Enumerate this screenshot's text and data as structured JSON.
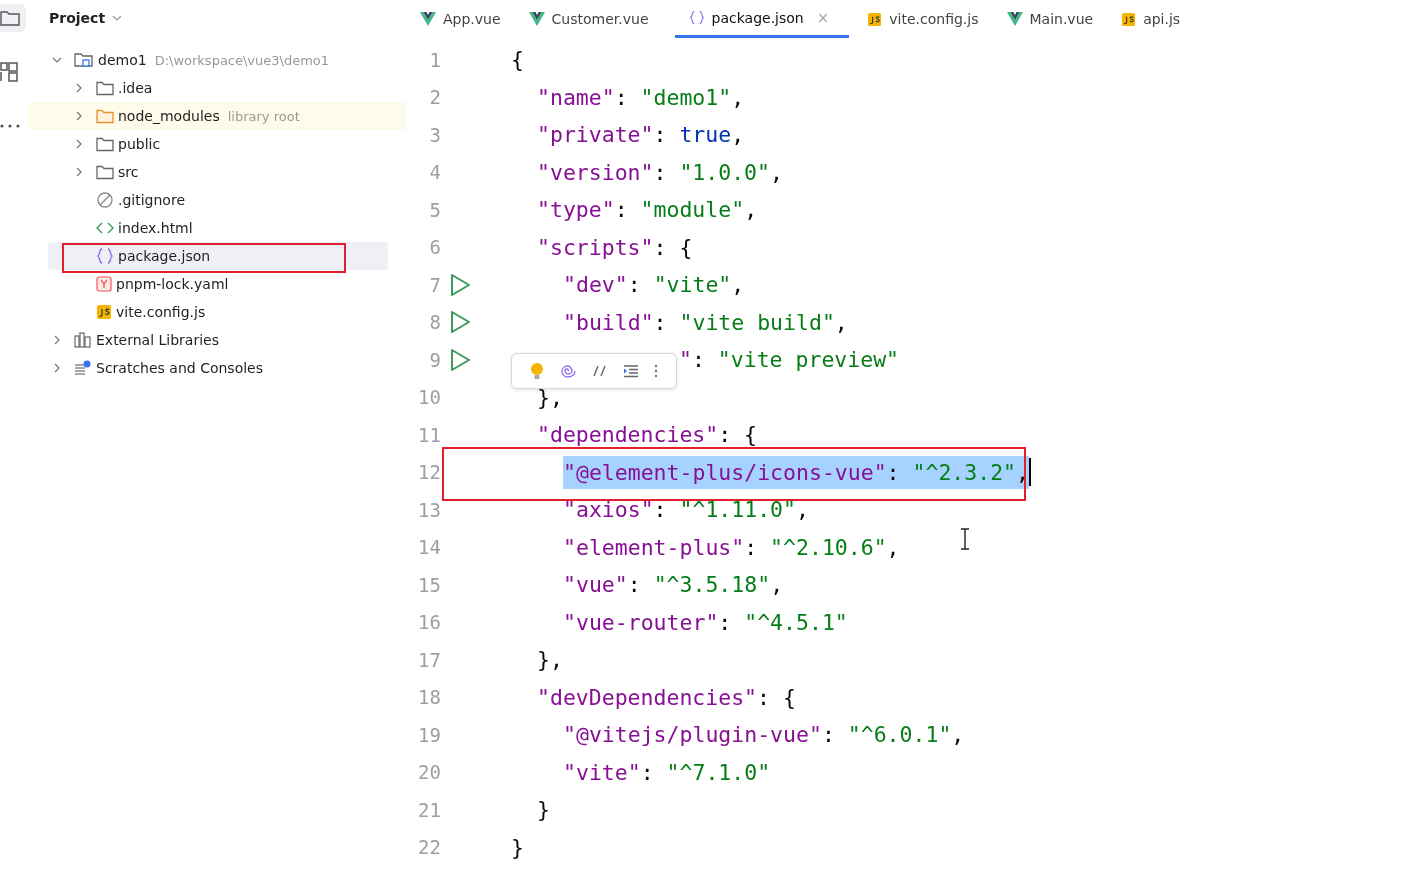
{
  "toolstrip": [
    {
      "kind": "folder",
      "selected": true
    },
    {
      "kind": "structure",
      "selected": false
    },
    {
      "kind": "more",
      "selected": false
    }
  ],
  "project": {
    "title": "Project",
    "tree": [
      {
        "label": "demo1",
        "hint": "D:\\workspace\\vue3\\demo1",
        "kind": "module",
        "expanded": true,
        "selected": false,
        "children": [
          {
            "label": ".idea",
            "kind": "folder",
            "expanded": false,
            "selected": false
          },
          {
            "label": "node_modules",
            "hint": "library root",
            "kind": "library-folder",
            "expanded": false,
            "selected": false
          },
          {
            "label": "public",
            "kind": "folder",
            "expanded": false,
            "selected": false
          },
          {
            "label": "src",
            "kind": "folder",
            "expanded": false,
            "selected": false
          },
          {
            "label": ".gitignore",
            "kind": "ignore",
            "selected": false
          },
          {
            "label": "index.html",
            "kind": "html",
            "selected": false
          },
          {
            "label": "package.json",
            "kind": "json",
            "selected": true,
            "marked": true
          },
          {
            "label": "pnpm-lock.yaml",
            "kind": "yaml",
            "selected": false
          },
          {
            "label": "vite.config.js",
            "kind": "js",
            "selected": false
          }
        ]
      },
      {
        "label": "External Libraries",
        "kind": "libraries",
        "expanded": false,
        "selected": false
      },
      {
        "label": "Scratches and Consoles",
        "kind": "scratches",
        "expanded": false,
        "selected": false
      }
    ]
  },
  "tabs": [
    {
      "label": "App.vue",
      "kind": "vue",
      "selected": false
    },
    {
      "label": "Customer.vue",
      "kind": "vue",
      "selected": false
    },
    {
      "label": "package.json",
      "kind": "json",
      "selected": true,
      "close": "×"
    },
    {
      "label": "vite.config.js",
      "kind": "js",
      "selected": false
    },
    {
      "label": "Main.vue",
      "kind": "vue",
      "selected": false
    },
    {
      "label": "api.js",
      "kind": "js",
      "selected": false
    }
  ],
  "editor": {
    "lines": [
      {
        "number": "1",
        "tokens": [
          {
            "kind": "punct",
            "text": "{"
          }
        ],
        "children": [
          {
            "number": "2",
            "tokens": [
              {
                "kind": "key",
                "text": "\"name\""
              },
              {
                "kind": "punct",
                "text": ": "
              },
              {
                "kind": "string",
                "text": "\"demo1\""
              },
              {
                "kind": "punct",
                "text": ","
              }
            ]
          },
          {
            "number": "3",
            "tokens": [
              {
                "kind": "key",
                "text": "\"private\""
              },
              {
                "kind": "punct",
                "text": ": "
              },
              {
                "kind": "keyword",
                "text": "true"
              },
              {
                "kind": "punct",
                "text": ","
              }
            ]
          },
          {
            "number": "4",
            "tokens": [
              {
                "kind": "key",
                "text": "\"version\""
              },
              {
                "kind": "punct",
                "text": ": "
              },
              {
                "kind": "string",
                "text": "\"1.0.0\""
              },
              {
                "kind": "punct",
                "text": ","
              }
            ]
          },
          {
            "number": "5",
            "tokens": [
              {
                "kind": "key",
                "text": "\"type\""
              },
              {
                "kind": "punct",
                "text": ": "
              },
              {
                "kind": "string",
                "text": "\"module\""
              },
              {
                "kind": "punct",
                "text": ","
              }
            ]
          },
          {
            "number": "6",
            "tokens": [
              {
                "kind": "key",
                "text": "\"scripts\""
              },
              {
                "kind": "punct",
                "text": ": {"
              }
            ],
            "children": [
              {
                "number": "7",
                "run": true,
                "tokens": [
                  {
                    "kind": "key",
                    "text": "\"dev\""
                  },
                  {
                    "kind": "punct",
                    "text": ": "
                  },
                  {
                    "kind": "string",
                    "text": "\"vite\""
                  },
                  {
                    "kind": "punct",
                    "text": ","
                  }
                ]
              },
              {
                "number": "8",
                "run": true,
                "tokens": [
                  {
                    "kind": "key",
                    "text": "\"build\""
                  },
                  {
                    "kind": "punct",
                    "text": ": "
                  },
                  {
                    "kind": "string",
                    "text": "\"vite build\""
                  },
                  {
                    "kind": "punct",
                    "text": ","
                  }
                ]
              },
              {
                "number": "9",
                "run": true,
                "popup": true,
                "tokens": [
                  {
                    "kind": "key",
                    "text": "\""
                  },
                  {
                    "kind": "punct",
                    "text": ": "
                  },
                  {
                    "kind": "string",
                    "text": "\"vite preview\""
                  }
                ]
              }
            ]
          },
          {
            "number": "10",
            "tokens": [
              {
                "kind": "punct",
                "text": "},"
              }
            ]
          },
          {
            "number": "11",
            "tokens": [
              {
                "kind": "key",
                "text": "\"dependencies\""
              },
              {
                "kind": "punct",
                "text": ": {"
              }
            ],
            "children": [
              {
                "number": "12",
                "current": true,
                "marked": true,
                "tokens": [
                  {
                    "kind": "key",
                    "text": "\"@element-plus/icons-vue\"",
                    "selected": true
                  },
                  {
                    "kind": "punct",
                    "text": ": ",
                    "selected": true
                  },
                  {
                    "kind": "string",
                    "text": "\"^2.3.2\"",
                    "selected": true
                  },
                  {
                    "kind": "punct",
                    "text": ",",
                    "selected": true
                  }
                ]
              },
              {
                "number": "13",
                "tokens": [
                  {
                    "kind": "key",
                    "text": "\"axios\""
                  },
                  {
                    "kind": "punct",
                    "text": ": "
                  },
                  {
                    "kind": "string",
                    "text": "\"^1.11.0\""
                  },
                  {
                    "kind": "punct",
                    "text": ","
                  }
                ]
              },
              {
                "number": "14",
                "tokens": [
                  {
                    "kind": "key",
                    "text": "\"element-plus\""
                  },
                  {
                    "kind": "punct",
                    "text": ": "
                  },
                  {
                    "kind": "string",
                    "text": "\"^2.10.6\""
                  },
                  {
                    "kind": "punct",
                    "text": ","
                  }
                ]
              },
              {
                "number": "15",
                "tokens": [
                  {
                    "kind": "key",
                    "text": "\"vue\""
                  },
                  {
                    "kind": "punct",
                    "text": ": "
                  },
                  {
                    "kind": "string",
                    "text": "\"^3.5.18\""
                  },
                  {
                    "kind": "punct",
                    "text": ","
                  }
                ]
              },
              {
                "number": "16",
                "tokens": [
                  {
                    "kind": "key",
                    "text": "\"vue-router\""
                  },
                  {
                    "kind": "punct",
                    "text": ": "
                  },
                  {
                    "kind": "string",
                    "text": "\"^4.5.1\""
                  }
                ]
              }
            ]
          },
          {
            "number": "17",
            "tokens": [
              {
                "kind": "punct",
                "text": "},"
              }
            ]
          },
          {
            "number": "18",
            "tokens": [
              {
                "kind": "key",
                "text": "\"devDependencies\""
              },
              {
                "kind": "punct",
                "text": ": {"
              }
            ],
            "children": [
              {
                "number": "19",
                "tokens": [
                  {
                    "kind": "key",
                    "text": "\"@vitejs/plugin-vue\""
                  },
                  {
                    "kind": "punct",
                    "text": ": "
                  },
                  {
                    "kind": "string",
                    "text": "\"^6.0.1\""
                  },
                  {
                    "kind": "punct",
                    "text": ","
                  }
                ]
              },
              {
                "number": "20",
                "tokens": [
                  {
                    "kind": "key",
                    "text": "\"vite\""
                  },
                  {
                    "kind": "punct",
                    "text": ": "
                  },
                  {
                    "kind": "string",
                    "text": "\"^7.1.0\""
                  }
                ]
              }
            ]
          },
          {
            "number": "21",
            "tokens": [
              {
                "kind": "punct",
                "text": "}"
              }
            ]
          }
        ]
      },
      {
        "number": "22",
        "tokens": [
          {
            "kind": "punct",
            "text": "}"
          }
        ]
      }
    ]
  }
}
